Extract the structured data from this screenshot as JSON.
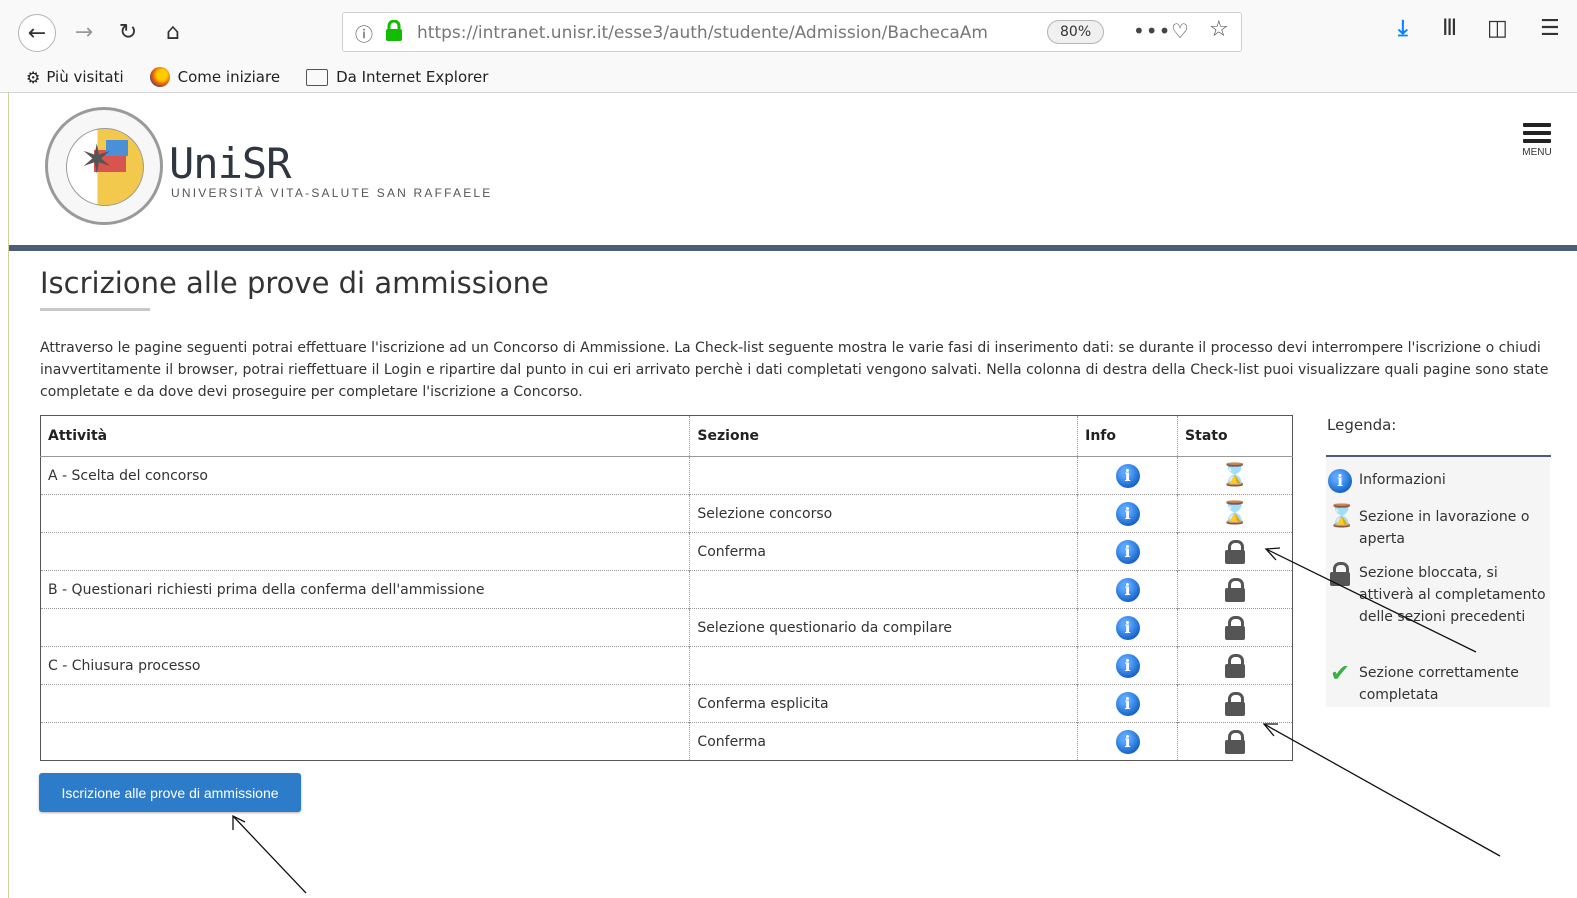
{
  "browser": {
    "url": "https://intranet.unisr.it/esse3/auth/studente/Admission/BachecaAm",
    "zoom": "80%",
    "more": "•••",
    "bookmarks": [
      {
        "label": "Più visitati"
      },
      {
        "label": "Come iniziare"
      },
      {
        "label": "Da Internet Explorer"
      }
    ]
  },
  "header": {
    "brand_name": "UniSR",
    "brand_sub": "UNIVERSITÀ VITA-SALUTE SAN RAFFAELE",
    "menu_label": "MENU"
  },
  "page": {
    "title": "Iscrizione alle prove di ammissione",
    "intro": "Attraverso le pagine seguenti potrai effettuare l'iscrizione ad un Concorso di Ammissione. La Check-list seguente mostra le varie fasi di inserimento dati: se durante il processo devi interrompere l'iscrizione o chiudi inavvertitamente il browser, potrai rieffettuare il Login e ripartire dal punto in cui eri arrivato perchè i dati completati vengono salvati. Nella colonna di destra della Check-list puoi visualizzare quali pagine sono state completate e da dove devi proseguire per completare l'iscrizione a Concorso."
  },
  "table": {
    "headers": {
      "activity": "Attività",
      "section": "Sezione",
      "info": "Info",
      "status": "Stato"
    },
    "rows": [
      {
        "activity": "A - Scelta del concorso",
        "section": "",
        "status": "hourglass"
      },
      {
        "activity": "",
        "section": "Selezione concorso",
        "status": "hourglass"
      },
      {
        "activity": "",
        "section": "Conferma",
        "status": "lock"
      },
      {
        "activity": "B - Questionari richiesti prima della conferma dell'ammissione",
        "section": "",
        "status": "lock"
      },
      {
        "activity": "",
        "section": "Selezione questionario da compilare",
        "status": "lock"
      },
      {
        "activity": "C - Chiusura processo",
        "section": "",
        "status": "lock"
      },
      {
        "activity": "",
        "section": "Conferma esplicita",
        "status": "lock"
      },
      {
        "activity": "",
        "section": "Conferma",
        "status": "lock"
      }
    ]
  },
  "legend": {
    "title": "Legenda:",
    "items": [
      {
        "icon": "info-icon",
        "text": "Informazioni"
      },
      {
        "icon": "hourglass-icon",
        "text": "Sezione in lavorazione o aperta"
      },
      {
        "icon": "lock-icon",
        "text": "Sezione bloccata, si attiverà al completamento delle sezioni precedenti"
      },
      {
        "icon": "check-icon",
        "text": "Sezione correttamente completata"
      }
    ]
  },
  "actions": {
    "submit_label": "Iscrizione alle prove di ammissione"
  },
  "colors": {
    "accent_button": "#2c7cc9",
    "header_line": "#4a5e7a",
    "info_blue": "#1767c9",
    "check_green": "#3cb043"
  }
}
